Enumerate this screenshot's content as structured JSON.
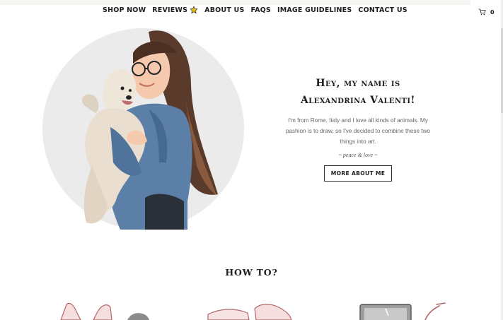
{
  "nav": {
    "items": [
      {
        "label": "SHOP NOW"
      },
      {
        "label": "REVIEWS"
      },
      {
        "label": "ABOUT US"
      },
      {
        "label": "FAQS"
      },
      {
        "label": "IMAGE GUIDELINES"
      },
      {
        "label": "CONTACT US"
      }
    ]
  },
  "cart": {
    "count": "0",
    "icon": "cart-icon"
  },
  "colors": {
    "accent_star": "#f2c100",
    "circle": "#ebebeb",
    "pink": "#e8b7ba"
  },
  "intro": {
    "heading_line1": "Hey, my name is",
    "heading_line2": "Alexandrina Valenti!",
    "description": "I'm from Rome, Italy and I love all kinds of animals. My pashion is to draw, so I've decided to combine these two things into art.",
    "signature": "~ peace & love ~",
    "button_label": "MORE ABOUT ME"
  },
  "section": {
    "howto_title": "HOW TO?"
  }
}
